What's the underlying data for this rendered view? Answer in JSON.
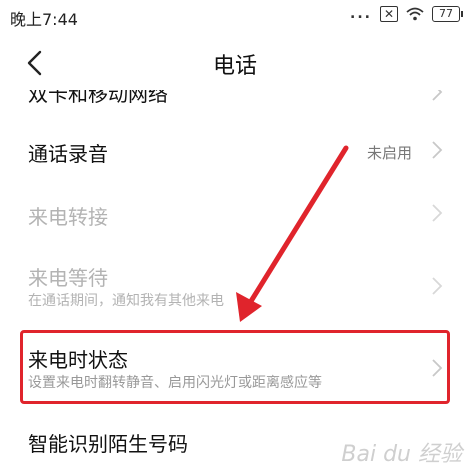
{
  "status_bar": {
    "time": "晚上7:44",
    "signal_dots": "...",
    "sim_x": "✕",
    "battery": "77"
  },
  "header": {
    "title": "电话"
  },
  "rows": {
    "partial_top": "双卡和移动网络",
    "call_recording": {
      "label": "通话录音",
      "value": "未启用"
    },
    "call_forwarding": {
      "label": "来电转接"
    },
    "call_waiting": {
      "label": "来电等待",
      "description": "在通话期间，通知我有其他来电"
    },
    "incoming_call_state": {
      "label": "来电时状态",
      "description": "设置来电时翻转静音、启用闪光灯或距离感应等"
    },
    "smart_caller_id": {
      "label": "智能识别陌生号码"
    }
  },
  "watermark": "Bai du 经验",
  "colors": {
    "highlight": "#e0242c",
    "disabled": "#b3b3b3"
  }
}
